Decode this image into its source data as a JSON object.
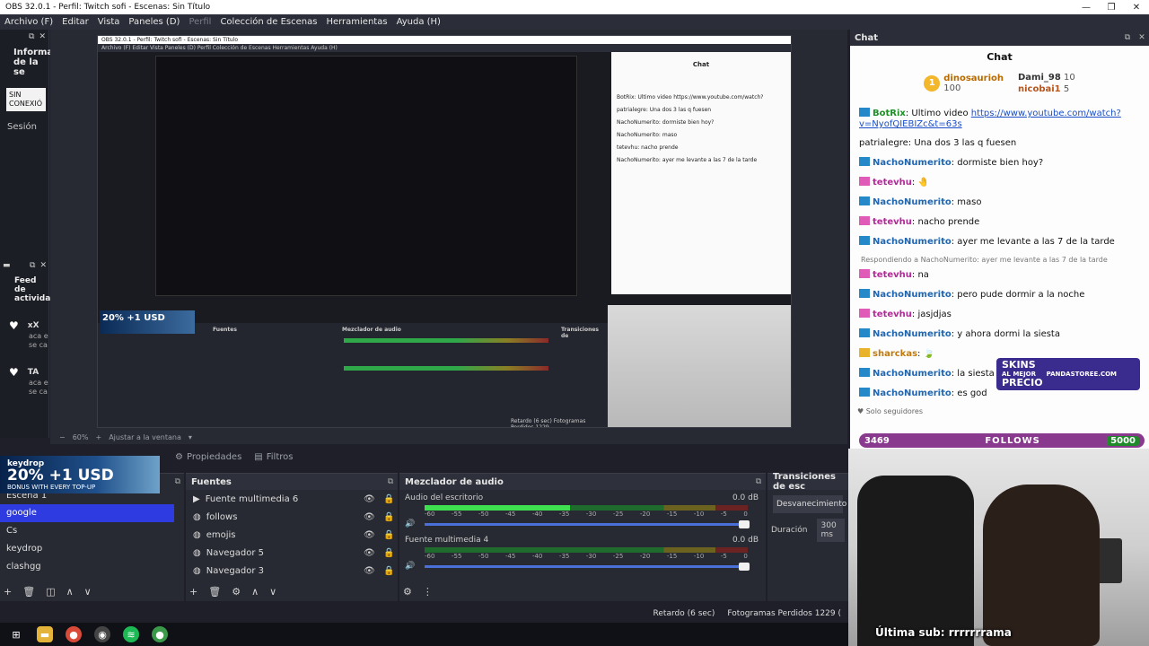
{
  "window": {
    "title": "OBS 32.0.1 - Perfil: Twitch sofi - Escenas: Sin Título"
  },
  "menu": [
    {
      "label": "Archivo (F)"
    },
    {
      "label": "Editar"
    },
    {
      "label": "Vista"
    },
    {
      "label": "Paneles (D)"
    },
    {
      "label": "Perfil",
      "disabled": true
    },
    {
      "label": "Colección de Escenas"
    },
    {
      "label": "Herramientas"
    },
    {
      "label": "Ayuda (H)"
    }
  ],
  "left_dock": {
    "info_title": "Informa de la se",
    "badge": "SIN CONEXIÓ",
    "session": "Sesión",
    "feed_title": "Feed de activida",
    "feed_items": [
      {
        "name": "xX",
        "sub": "aca e se ca"
      },
      {
        "name": "TA",
        "sub": "aca e se ca"
      }
    ]
  },
  "preview": {
    "zoom": "60%",
    "fit_label": "Ajustar a la ventana"
  },
  "nested": {
    "title": "OBS 32.0.1 - Perfil: Twitch sofi - Escenas: Sin Título",
    "menu": "Archivo (F)   Editar   Vista   Paneles (D)   Perfil   Colección de Escenas   Herramientas   Ayuda (H)",
    "chat_title": "Chat",
    "chat_lines": [
      "BotRix: Ultimo video https://www.youtube.com/watch?",
      "patrialegre: Una dos 3 las q fuesen",
      "NachoNumerito: dormiste bien hoy?",
      "NachoNumerito: maso",
      "tetevhu: nacho prende",
      "NachoNumerito: ayer me levante a las 7 de la tarde"
    ],
    "sources_title": "Fuentes",
    "mixer_title": "Mezclador de audio",
    "trans_title": "Transiciones de",
    "status": "Retardo (6 sec)   Fotogramas Perdidos 1229"
  },
  "toolbar": {
    "properties": "Propiedades",
    "filters": "Filtros"
  },
  "banner": {
    "brand": "keydrop",
    "promo": "20% +1 USD",
    "sub": "BONUS WITH EVERY TOP-UP"
  },
  "scenes": {
    "top_item": "Escena 1",
    "items": [
      {
        "label": "google",
        "selected": true
      },
      {
        "label": "Cs"
      },
      {
        "label": "keydrop"
      },
      {
        "label": "clashgg"
      }
    ]
  },
  "sources": {
    "title": "Fuentes",
    "items": [
      {
        "label": "Fuente multimedia 6",
        "icon": "play-icon"
      },
      {
        "label": "follows",
        "icon": "globe-icon"
      },
      {
        "label": "emojis",
        "icon": "globe-icon"
      },
      {
        "label": "Navegador 5",
        "icon": "globe-icon"
      },
      {
        "label": "Navegador 3",
        "icon": "globe-icon"
      }
    ]
  },
  "mixer": {
    "title": "Mezclador de audio",
    "scale": [
      "-60",
      "-55",
      "-50",
      "-45",
      "-40",
      "-35",
      "-30",
      "-25",
      "-20",
      "-15",
      "-10",
      "-5",
      "0"
    ],
    "channels": [
      {
        "label": "Audio del escritorio",
        "db": "0.0 dB",
        "level": 0.45
      },
      {
        "label": "Fuente multimedia 4",
        "db": "0.0 dB",
        "level": 0.0
      }
    ]
  },
  "transitions": {
    "title": "Transiciones de esc",
    "selected": "Desvanecimiento",
    "duration_label": "Duración",
    "duration_value": "300 ms"
  },
  "status": {
    "delay": "Retardo (6 sec)",
    "frames": "Fotogramas Perdidos 1229 ("
  },
  "chat": {
    "dock_title": "Chat",
    "title": "Chat",
    "first": {
      "rank": "1",
      "name": "dinosaurioh",
      "points": "100"
    },
    "second": {
      "name": "Dami_98",
      "points": "10"
    },
    "third": {
      "name": "nicobai1",
      "points": "5"
    },
    "lines": [
      {
        "user": "BotRix",
        "color": "user-green",
        "icon": "blue",
        "text": "Ultimo video ",
        "link": "https://www.youtube.com/watch?v=NyofQIEBIZc&t=63s"
      },
      {
        "user": "patrialegre",
        "color": "plain",
        "icon": "none",
        "text": "Una dos 3 las q fuesen"
      },
      {
        "user": "NachoNumerito",
        "color": "user-blue",
        "icon": "blue",
        "text": "dormiste bien hoy?"
      },
      {
        "user": "tetevhu",
        "color": "user-pink",
        "icon": "pink",
        "text": "🤚"
      },
      {
        "user": "NachoNumerito",
        "color": "user-blue",
        "icon": "blue",
        "text": "maso"
      },
      {
        "user": "tetevhu",
        "color": "user-pink",
        "icon": "pink",
        "text": "nacho prende"
      },
      {
        "user": "NachoNumerito",
        "color": "user-blue",
        "icon": "blue",
        "text": "ayer me levante a las 7 de la tarde"
      }
    ],
    "reply": "Respondiendo a NachoNumerito: ayer me levante a las 7 de la tarde",
    "lines2": [
      {
        "user": "tetevhu",
        "color": "user-pink",
        "icon": "pink",
        "text": "na"
      },
      {
        "user": "NachoNumerito",
        "color": "user-blue",
        "icon": "blue",
        "text": "pero pude dormir a la noche"
      },
      {
        "user": "tetevhu",
        "color": "user-pink",
        "icon": "pink",
        "text": "jasjdjas"
      },
      {
        "user": "NachoNumerito",
        "color": "user-blue",
        "icon": "blue",
        "text": "y ahora dormi la siesta"
      },
      {
        "user": "sharckas",
        "color": "user-orange",
        "icon": "gold",
        "text": "🍃"
      },
      {
        "user": "NachoNumerito",
        "color": "user-blue",
        "icon": "blue",
        "text": "la siesta dsp d"
      },
      {
        "user": "NachoNumerito",
        "color": "user-blue",
        "icon": "blue",
        "text": "es god"
      }
    ],
    "followers_only": "Solo seguidores",
    "ad": {
      "main1": "SKINS",
      "main2": "AL MEJOR",
      "main3": "PRECIO",
      "site": "PANDASTOREE.COM"
    }
  },
  "followbar": {
    "count": "3469",
    "label": "FOLLOWS",
    "goal": "5000"
  },
  "webcam": {
    "last_sub": "Última sub: rrrrrrrama"
  },
  "colors": {
    "accent": "#2e3be0",
    "chat_bg": "#fdfdfd",
    "obs_bg": "#272a33"
  }
}
